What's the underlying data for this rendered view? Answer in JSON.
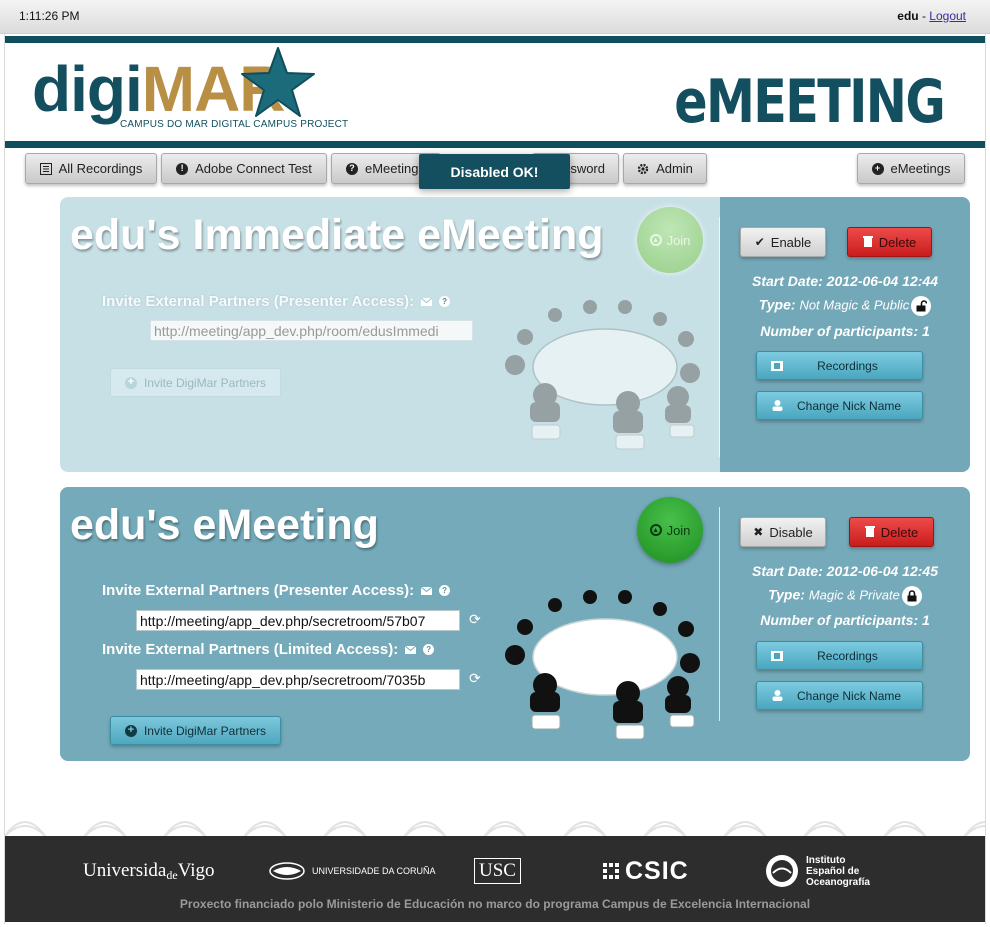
{
  "header": {
    "clock": "1:11:26 PM",
    "user": "edu",
    "separator": " - ",
    "logout_label": "Logout"
  },
  "brand": {
    "logo_digi": "digi",
    "logo_mar": "MAR",
    "logo_tagline": "CAMPUS DO MAR DIGITAL CAMPUS PROJECT",
    "product_title": "eMEETING",
    "colors": {
      "brand_teal": "#0f4e5c",
      "logo_gold": "#b98f45"
    }
  },
  "nav": {
    "all_recordings": "All Recordings",
    "adobe_connect_test": "Adobe Connect Test",
    "emeeting": "eMeeting",
    "password": "sword",
    "admin": "Admin",
    "emeetings": "eMeetings"
  },
  "toast": {
    "message": "Disabled OK!"
  },
  "meetings": [
    {
      "title": "edu's Immediate eMeeting",
      "join_label": "Join",
      "presenter_label": "Invite External Partners (Presenter Access):",
      "presenter_url": "http://meeting/app_dev.php/room/edusImmedi",
      "invite_digimar_label": "Invite DigiMar Partners",
      "toggle_label": "Enable",
      "delete_label": "Delete",
      "start_date": "Start Date: 2012-06-04 12:44",
      "type_label": "Type:",
      "type_value": "Not Magic & Public",
      "participants": "Number of participants: 1",
      "recordings_label": "Recordings",
      "change_nick_label": "Change Nick Name",
      "state": "disabled"
    },
    {
      "title": "edu's eMeeting",
      "join_label": "Join",
      "presenter_label": "Invite External Partners (Presenter Access):",
      "presenter_url": "http://meeting/app_dev.php/secretroom/57b07",
      "limited_label": "Invite External Partners (Limited Access):",
      "limited_url": "http://meeting/app_dev.php/secretroom/7035b",
      "invite_digimar_label": "Invite DigiMar Partners",
      "toggle_label": "Disable",
      "delete_label": "Delete",
      "start_date": "Start Date: 2012-06-04 12:45",
      "type_label": "Type:",
      "type_value": "Magic & Private",
      "participants": "Number of participants: 1",
      "recordings_label": "Recordings",
      "change_nick_label": "Change Nick Name",
      "state": "enabled"
    }
  ],
  "footer": {
    "partners": {
      "uvigo_a": "Universida",
      "uvigo_de": "de",
      "uvigo_b": "Vigo",
      "udc": "UNIVERSIDADE DA CORUÑA",
      "usc": "USC",
      "csic": "CSIC",
      "ieo_1": "Instituto",
      "ieo_2": "Español de",
      "ieo_3": "Oceanografía"
    },
    "note": "Proxecto financiado polo Ministerio de Educación no marco do programa Campus de Excelencia Internacional"
  }
}
